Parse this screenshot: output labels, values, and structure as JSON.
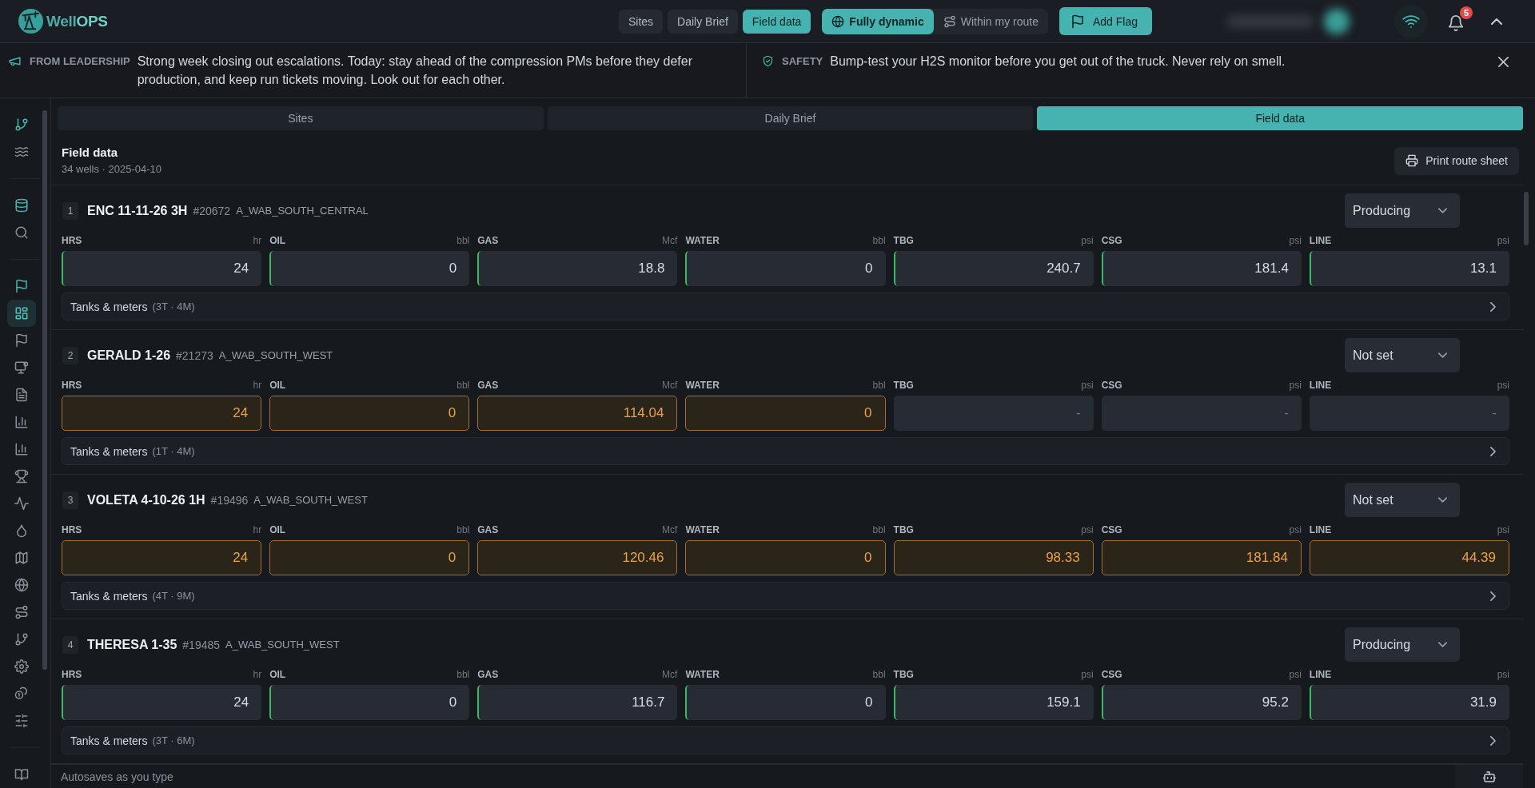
{
  "header": {
    "logo": {
      "wordmark_part_1": "Well",
      "wordmark_part_2": "OPS"
    },
    "nav_tabs": [
      {
        "label": "Sites",
        "selected": false
      },
      {
        "label": "Daily Brief",
        "selected": false
      },
      {
        "label": "Field data",
        "selected": true
      }
    ],
    "mode_toggle": [
      {
        "label": "Fully dynamic",
        "selected": true
      },
      {
        "label": "Within my route",
        "selected": false
      }
    ],
    "add_flag_button": "Add Flag",
    "notifications": {
      "count": "5"
    }
  },
  "announcements": [
    {
      "kind": "leadership",
      "label": "FROM LEADERSHIP",
      "message": "Strong week closing out escalations. Today: stay ahead of the compression PMs before they defer production, and keep run tickets moving. Look out for each other."
    },
    {
      "kind": "safety",
      "label": "SAFETY",
      "message": "Bump-test your H2S monitor before you get out of the truck. Never rely on smell."
    }
  ],
  "sidebar": {
    "groups": [
      {
        "items": [
          {
            "accent": true,
            "selected": false
          },
          {
            "accent": false,
            "selected": false
          }
        ]
      },
      {
        "items": [
          {
            "accent": true,
            "selected": false
          },
          {
            "accent": false,
            "selected": false
          }
        ]
      },
      {
        "items": [
          {
            "accent": true,
            "selected": false
          },
          {
            "accent": false,
            "selected": true
          },
          {
            "accent": false,
            "selected": false
          },
          {
            "accent": false,
            "selected": false
          },
          {
            "accent": false,
            "selected": false
          },
          {
            "accent": false,
            "selected": false
          },
          {
            "accent": false,
            "selected": false
          },
          {
            "accent": false,
            "selected": false
          },
          {
            "accent": false,
            "selected": false
          },
          {
            "accent": false,
            "selected": false
          },
          {
            "accent": false,
            "selected": false
          },
          {
            "accent": false,
            "selected": false
          },
          {
            "accent": false,
            "selected": false
          },
          {
            "accent": false,
            "selected": false
          },
          {
            "accent": false,
            "selected": false
          },
          {
            "accent": false,
            "selected": false
          },
          {
            "accent": false,
            "selected": false
          }
        ]
      },
      {
        "items": [
          {
            "accent": false,
            "selected": false
          }
        ]
      }
    ]
  },
  "view_tabs": [
    {
      "label": "Sites",
      "selected": false
    },
    {
      "label": "Daily Brief",
      "selected": false
    },
    {
      "label": "Field data",
      "selected": true
    }
  ],
  "field_data": {
    "title": "Field data",
    "subtitle": "34 wells · 2025-04-10",
    "print_button": "Print route sheet",
    "wells": [
      {
        "number": "1",
        "name": "ENC 11-11-26 3H",
        "id": "#20672",
        "area": "A_WAB_SOUTH_CENTRAL",
        "status": "Producing",
        "fields": [
          {
            "label": "HRS",
            "unit": "hr",
            "value": "24",
            "confirmed": true,
            "flagged": false
          },
          {
            "label": "OIL",
            "unit": "bbl",
            "value": "0",
            "confirmed": true,
            "flagged": false
          },
          {
            "label": "GAS",
            "unit": "Mcf",
            "value": "18.8",
            "confirmed": true,
            "flagged": false
          },
          {
            "label": "WATER",
            "unit": "bbl",
            "value": "0",
            "confirmed": true,
            "flagged": false
          },
          {
            "label": "TBG",
            "unit": "psi",
            "value": "240.7",
            "confirmed": true,
            "flagged": false
          },
          {
            "label": "CSG",
            "unit": "psi",
            "value": "181.4",
            "confirmed": true,
            "flagged": false
          },
          {
            "label": "LINE",
            "unit": "psi",
            "value": "13.1",
            "confirmed": true,
            "flagged": false
          }
        ],
        "tanks": {
          "label": "Tanks & meters",
          "count": "(3T · 4M)",
          "expanded": false
        }
      },
      {
        "number": "2",
        "name": "GERALD 1-26",
        "id": "#21273",
        "area": "A_WAB_SOUTH_WEST",
        "status": "Not set",
        "fields": [
          {
            "label": "HRS",
            "unit": "hr",
            "value": "24",
            "confirmed": false,
            "flagged": true
          },
          {
            "label": "OIL",
            "unit": "bbl",
            "value": "0",
            "confirmed": false,
            "flagged": true
          },
          {
            "label": "GAS",
            "unit": "Mcf",
            "value": "114.04",
            "confirmed": false,
            "flagged": true
          },
          {
            "label": "WATER",
            "unit": "bbl",
            "value": "0",
            "confirmed": false,
            "flagged": true
          },
          {
            "label": "TBG",
            "unit": "psi",
            "placeholder": "-",
            "confirmed": false,
            "flagged": false
          },
          {
            "label": "CSG",
            "unit": "psi",
            "placeholder": "-",
            "confirmed": false,
            "flagged": false
          },
          {
            "label": "LINE",
            "unit": "psi",
            "placeholder": "-",
            "confirmed": false,
            "flagged": false
          }
        ],
        "tanks": {
          "label": "Tanks & meters",
          "count": "(1T · 4M)",
          "expanded": false
        }
      },
      {
        "number": "3",
        "name": "VOLETA 4-10-26 1H",
        "id": "#19496",
        "area": "A_WAB_SOUTH_WEST",
        "status": "Not set",
        "fields": [
          {
            "label": "HRS",
            "unit": "hr",
            "value": "24",
            "confirmed": false,
            "flagged": true
          },
          {
            "label": "OIL",
            "unit": "bbl",
            "value": "0",
            "confirmed": false,
            "flagged": true
          },
          {
            "label": "GAS",
            "unit": "Mcf",
            "value": "120.46",
            "confirmed": false,
            "flagged": true
          },
          {
            "label": "WATER",
            "unit": "bbl",
            "value": "0",
            "confirmed": false,
            "flagged": true
          },
          {
            "label": "TBG",
            "unit": "psi",
            "value": "98.33",
            "confirmed": false,
            "flagged": true
          },
          {
            "label": "CSG",
            "unit": "psi",
            "value": "181.84",
            "confirmed": false,
            "flagged": true
          },
          {
            "label": "LINE",
            "unit": "psi",
            "value": "44.39",
            "confirmed": false,
            "flagged": true
          }
        ],
        "tanks": {
          "label": "Tanks & meters",
          "count": "(4T · 9M)",
          "expanded": false
        }
      },
      {
        "number": "4",
        "name": "THERESA 1-35",
        "id": "#19485",
        "area": "A_WAB_SOUTH_WEST",
        "status": "Producing",
        "fields": [
          {
            "label": "HRS",
            "unit": "hr",
            "value": "24",
            "confirmed": true,
            "flagged": false
          },
          {
            "label": "OIL",
            "unit": "bbl",
            "value": "0",
            "confirmed": true,
            "flagged": false
          },
          {
            "label": "GAS",
            "unit": "Mcf",
            "value": "116.7",
            "confirmed": true,
            "flagged": false
          },
          {
            "label": "WATER",
            "unit": "bbl",
            "value": "0",
            "confirmed": true,
            "flagged": false
          },
          {
            "label": "TBG",
            "unit": "psi",
            "value": "159.1",
            "confirmed": true,
            "flagged": false
          },
          {
            "label": "CSG",
            "unit": "psi",
            "value": "95.2",
            "confirmed": true,
            "flagged": false
          },
          {
            "label": "LINE",
            "unit": "psi",
            "value": "31.9",
            "confirmed": true,
            "flagged": false
          }
        ],
        "tanks": {
          "label": "Tanks & meters",
          "count": "(3T · 6M)",
          "expanded": false
        }
      }
    ]
  },
  "footer": {
    "note": "Autosaves as you type"
  }
}
